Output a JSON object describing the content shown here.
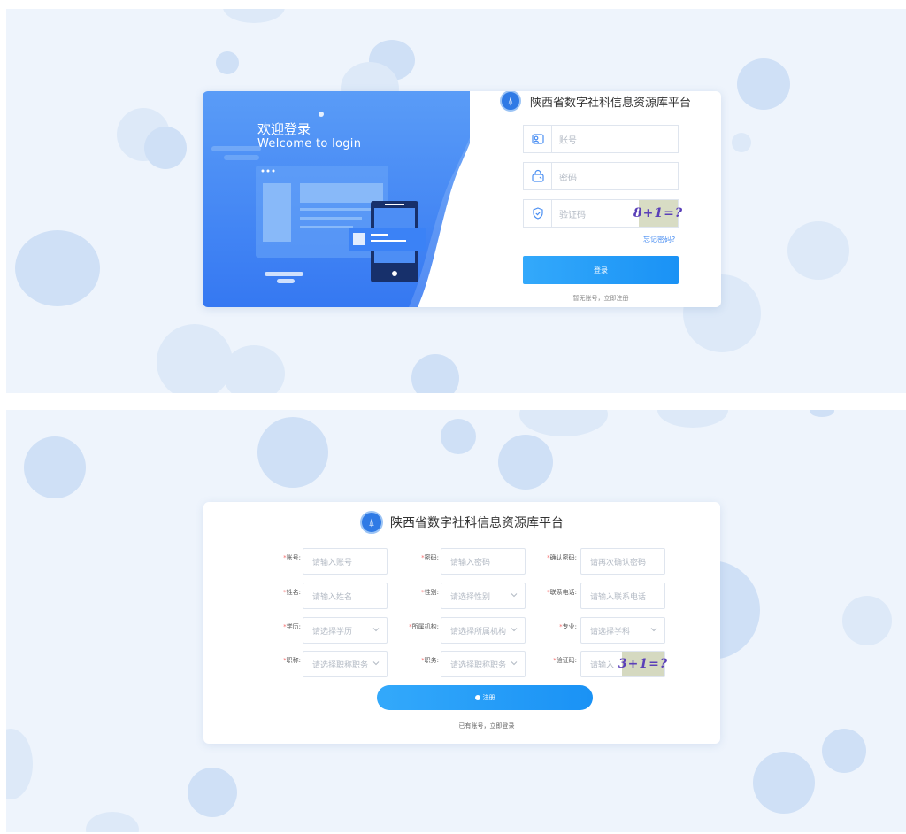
{
  "colors": {
    "accent": "#1a92f5",
    "panel_bg": "#eef4fc",
    "required": "#f56c6c"
  },
  "login": {
    "welcome_cn": "欢迎登录",
    "welcome_en": "Welcome to login",
    "platform_title": "陕西省数字社科信息资源库平台",
    "account_placeholder": "账号",
    "password_placeholder": "密码",
    "captcha_placeholder": "验证码",
    "captcha_text": "8+1=?",
    "forgot_password": "忘记密码?",
    "login_button": "登录",
    "register_prompt": "暂无账号，立即注册",
    "icons": [
      "user-icon",
      "lock-icon",
      "shield-icon"
    ]
  },
  "register": {
    "platform_title": "陕西省数字社科信息资源库平台",
    "fields": {
      "account": {
        "label": "账号:",
        "placeholder": "请输入账号"
      },
      "password": {
        "label": "密码:",
        "placeholder": "请输入密码"
      },
      "confirm_password": {
        "label": "确认密码:",
        "placeholder": "请再次确认密码"
      },
      "name": {
        "label": "姓名:",
        "placeholder": "请输入姓名"
      },
      "gender": {
        "label": "性别:",
        "placeholder": "请选择性别"
      },
      "phone": {
        "label": "联系电话:",
        "placeholder": "请输入联系电话"
      },
      "education": {
        "label": "学历:",
        "placeholder": "请选择学历"
      },
      "institution": {
        "label": "所属机构:",
        "placeholder": "请选择所属机构"
      },
      "major": {
        "label": "专业:",
        "placeholder": "请选择学科"
      },
      "title": {
        "label": "职称:",
        "placeholder": "请选择职称职务"
      },
      "position": {
        "label": "职务:",
        "placeholder": "请选择职称职务"
      },
      "captcha": {
        "label": "验证码:",
        "placeholder": "请输入"
      }
    },
    "required_mark": "*",
    "captcha_text": "3+1=?",
    "register_button": "注册",
    "login_prompt": "已有账号，立即登录"
  }
}
